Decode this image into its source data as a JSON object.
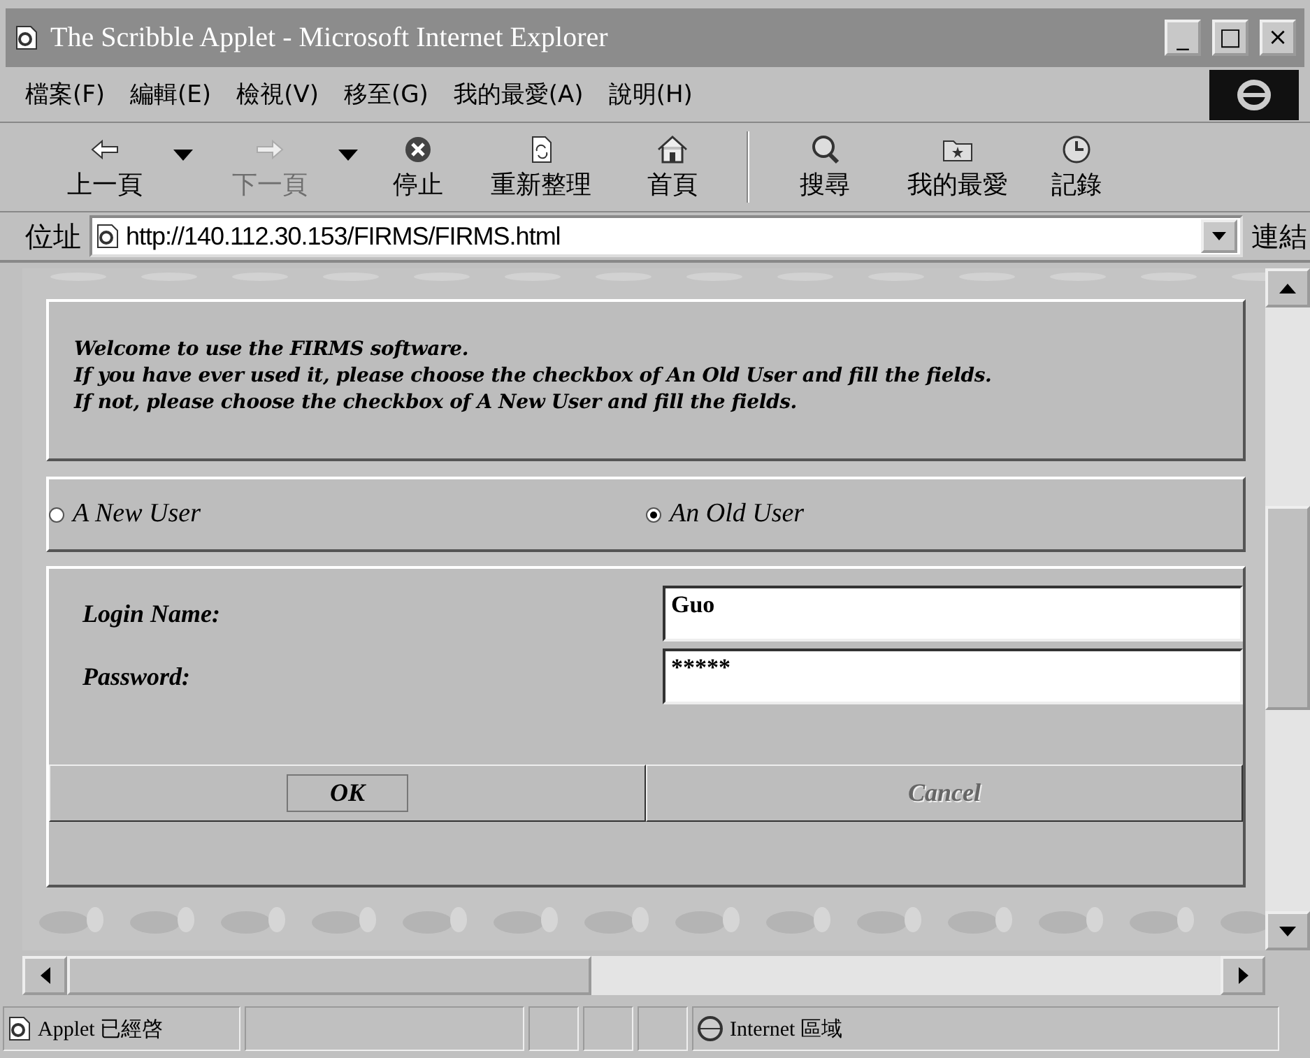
{
  "window": {
    "title": "The Scribble Applet - Microsoft Internet Explorer",
    "controls": [
      "_",
      "□",
      "×"
    ]
  },
  "menu": [
    "檔案(F)",
    "編輯(E)",
    "檢視(V)",
    "移至(G)",
    "我的最愛(A)",
    "說明(H)"
  ],
  "toolbar": [
    {
      "kind": "back",
      "label": "上一頁",
      "disabled": false,
      "dropdown": true
    },
    {
      "kind": "forward",
      "label": "下一頁",
      "disabled": true,
      "dropdown": true
    },
    {
      "kind": "stop",
      "label": "停止",
      "disabled": false,
      "dropdown": false
    },
    {
      "kind": "refresh",
      "label": "重新整理",
      "disabled": false,
      "dropdown": false
    },
    {
      "kind": "home",
      "label": "首頁",
      "disabled": false,
      "dropdown": false
    },
    {
      "kind": "search",
      "label": "搜尋",
      "disabled": false,
      "dropdown": false
    },
    {
      "kind": "favorites",
      "label": "我的最愛",
      "disabled": false,
      "dropdown": false
    },
    {
      "kind": "history",
      "label": "記錄",
      "disabled": false,
      "dropdown": false
    }
  ],
  "address": {
    "label": "位址",
    "url": "http://140.112.30.153/FIRMS/FIRMS.html",
    "links": "連結"
  },
  "page": {
    "intro": [
      "Welcome to use the FIRMS software.",
      "If you have ever used it, please choose the checkbox of An Old User and fill the fields.",
      "If not, please choose the checkbox of A New User and fill the fields."
    ],
    "options": [
      {
        "label": "A New User",
        "selected": false
      },
      {
        "label": "An Old User",
        "selected": true
      }
    ],
    "fields": [
      {
        "label": "Login Name:",
        "value": "Guo"
      },
      {
        "label": "Password:",
        "value": "*****"
      }
    ],
    "buttons": [
      {
        "label": "OK",
        "disabled": false
      },
      {
        "label": "Cancel",
        "disabled": true
      }
    ]
  },
  "status_bar": {
    "message": "Applet 已經啓",
    "zone": "Internet 區域"
  }
}
